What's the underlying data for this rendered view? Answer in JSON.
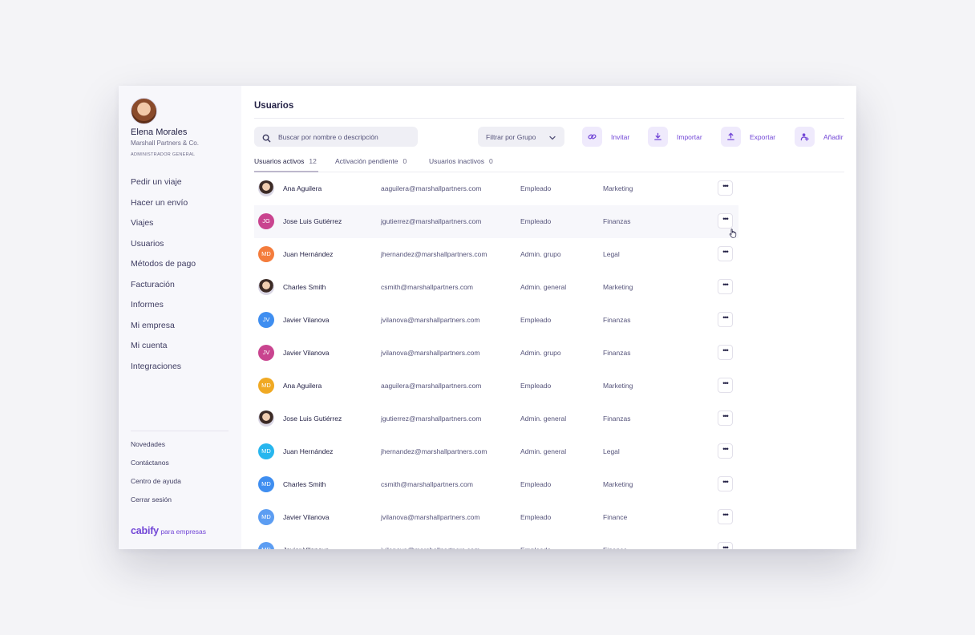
{
  "profile": {
    "name": "Elena Morales",
    "company": "Marshall Partners & Co.",
    "role": "ADMINISTRADOR GENERAL"
  },
  "nav": {
    "primary": [
      "Pedir un viaje",
      "Hacer un envío",
      "Viajes",
      "Usuarios",
      "Métodos de pago",
      "Facturación",
      "Informes",
      "Mi empresa",
      "Mi cuenta",
      "Integraciones"
    ],
    "secondary": [
      "Novedades",
      "Contáctanos",
      "Centro de ayuda",
      "Cerrar sesión"
    ]
  },
  "logo": {
    "brand": "cabify",
    "suffix": "para empresas"
  },
  "page": {
    "title": "Usuarios"
  },
  "toolbar": {
    "search_placeholder": "Buscar por nombre o descripción",
    "filter_label": "Filtrar por Grupo",
    "invite": "Invitar",
    "import": "Importar",
    "export": "Exportar",
    "add": "Añadir"
  },
  "tabs": [
    {
      "label": "Usuarios activos",
      "count": "12"
    },
    {
      "label": "Activación pendiente",
      "count": "0"
    },
    {
      "label": "Usuarios inactivos",
      "count": "0"
    }
  ],
  "colors": {
    "accent": "#7145d6",
    "avatar_pink": "#c9448f",
    "avatar_orange": "#f47c3c",
    "avatar_blue": "#3f8ef0",
    "avatar_amber": "#f0a923",
    "avatar_cyan": "#27b6ee",
    "avatar_lightblue": "#5c9df2"
  },
  "users": [
    {
      "initials": "",
      "avatar": "photo",
      "color": "",
      "name": "Ana Aguilera",
      "email": "aaguilera@marshallpartners.com",
      "role": "Empleado",
      "group": "Marketing"
    },
    {
      "initials": "JG",
      "avatar": "initials",
      "color": "#c9448f",
      "name": "Jose Luis Gutiérrez",
      "email": "jgutierrez@marshallpartners.com",
      "role": "Empleado",
      "group": "Finanzas"
    },
    {
      "initials": "MD",
      "avatar": "initials",
      "color": "#f47c3c",
      "name": "Juan Hernández",
      "email": "jhernandez@marshallpartners.com",
      "role": "Admin. grupo",
      "group": "Legal"
    },
    {
      "initials": "",
      "avatar": "photo",
      "color": "",
      "name": "Charles Smith",
      "email": "csmith@marshallpartners.com",
      "role": "Admin. general",
      "group": "Marketing"
    },
    {
      "initials": "JV",
      "avatar": "initials",
      "color": "#3f8ef0",
      "name": "Javier Vilanova",
      "email": "jvilanova@marshallpartners.com",
      "role": "Empleado",
      "group": "Finanzas"
    },
    {
      "initials": "JV",
      "avatar": "initials",
      "color": "#c9448f",
      "name": "Javier Vilanova",
      "email": "jvilanova@marshallpartners.com",
      "role": "Admin. grupo",
      "group": "Finanzas"
    },
    {
      "initials": "MD",
      "avatar": "initials",
      "color": "#f0a923",
      "name": "Ana Aguilera",
      "email": "aaguilera@marshallpartners.com",
      "role": "Empleado",
      "group": "Marketing"
    },
    {
      "initials": "",
      "avatar": "photo",
      "color": "",
      "name": "Jose Luis Gutiérrez",
      "email": "jgutierrez@marshallpartners.com",
      "role": "Admin. general",
      "group": "Finanzas"
    },
    {
      "initials": "MD",
      "avatar": "initials",
      "color": "#27b6ee",
      "name": "Juan Hernández",
      "email": "jhernandez@marshallpartners.com",
      "role": "Admin. general",
      "group": "Legal"
    },
    {
      "initials": "MD",
      "avatar": "initials",
      "color": "#3f8ef0",
      "name": "Charles Smith",
      "email": "csmith@marshallpartners.com",
      "role": "Empleado",
      "group": "Marketing"
    },
    {
      "initials": "MD",
      "avatar": "initials",
      "color": "#5c9df2",
      "name": "Javier Vilanova",
      "email": "jvilanova@marshallpartners.com",
      "role": "Empleado",
      "group": "Finance"
    },
    {
      "initials": "MD",
      "avatar": "initials",
      "color": "#5c9df2",
      "name": "Javier Vilanova",
      "email": "jvilanova@marshallpartners.com",
      "role": "Empleado",
      "group": "Finance"
    }
  ],
  "row_actions_label": "•••"
}
